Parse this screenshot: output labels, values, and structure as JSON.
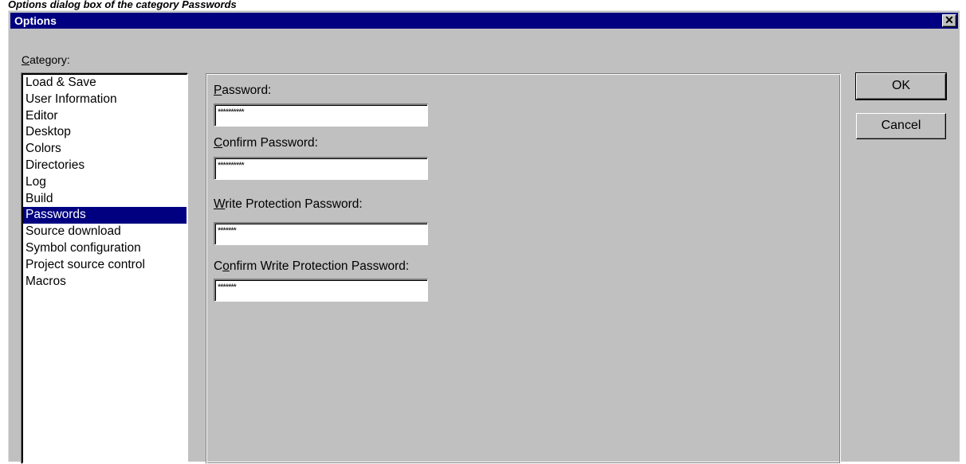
{
  "caption": "Options dialog box of the category Passwords",
  "window": {
    "title": "Options",
    "close_glyph": "✕"
  },
  "category": {
    "label_accel": "C",
    "label_rest": "ategory:",
    "items": [
      {
        "label": "Load & Save",
        "selected": false
      },
      {
        "label": "User Information",
        "selected": false
      },
      {
        "label": "Editor",
        "selected": false
      },
      {
        "label": "Desktop",
        "selected": false
      },
      {
        "label": "Colors",
        "selected": false
      },
      {
        "label": "Directories",
        "selected": false
      },
      {
        "label": "Log",
        "selected": false
      },
      {
        "label": "Build",
        "selected": false
      },
      {
        "label": "Passwords",
        "selected": true
      },
      {
        "label": "Source download",
        "selected": false
      },
      {
        "label": "Symbol configuration",
        "selected": false
      },
      {
        "label": "Project source control",
        "selected": false
      },
      {
        "label": "Macros",
        "selected": false
      }
    ]
  },
  "passwords": {
    "password": {
      "label_accel": "P",
      "label_rest": "assword:",
      "value": "**********"
    },
    "confirm_password": {
      "label_accel": "C",
      "label_rest": "onfirm Password:",
      "value": "**********"
    },
    "write_protection_password": {
      "label_accel": "W",
      "label_rest": "rite Protection Password:",
      "value": "*******"
    },
    "confirm_write_protection_password": {
      "label_pre": "C",
      "label_accel": "o",
      "label_rest": "nfirm Write Protection Password:",
      "value": "*******"
    }
  },
  "buttons": {
    "ok": "OK",
    "cancel": "Cancel"
  },
  "colors": {
    "titlebar": "#000080",
    "dialog_face": "#c0c0c0",
    "selection": "#000080"
  }
}
